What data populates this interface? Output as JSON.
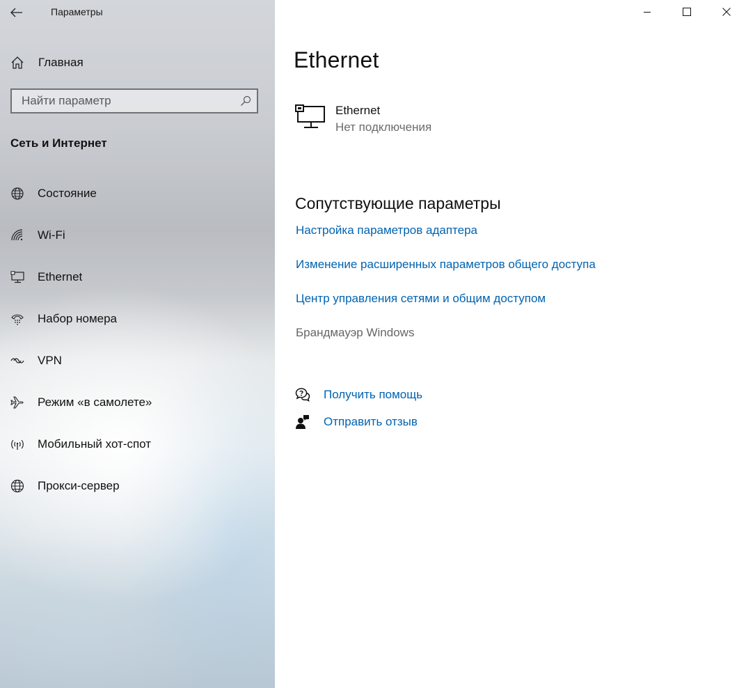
{
  "window": {
    "app_title": "Параметры",
    "controls": [
      "minimize",
      "maximize",
      "close"
    ]
  },
  "sidebar": {
    "home_label": "Главная",
    "search": {
      "placeholder": "Найти параметр",
      "value": ""
    },
    "section_title": "Сеть и Интернет",
    "items": [
      {
        "label": "Состояние",
        "icon": "globe-status-icon"
      },
      {
        "label": "Wi-Fi",
        "icon": "wifi-icon"
      },
      {
        "label": "Ethernet",
        "icon": "ethernet-icon"
      },
      {
        "label": "Набор номера",
        "icon": "dialup-icon"
      },
      {
        "label": "VPN",
        "icon": "vpn-icon"
      },
      {
        "label": "Режим «в самолете»",
        "icon": "airplane-icon"
      },
      {
        "label": "Мобильный хот-спот",
        "icon": "hotspot-icon"
      },
      {
        "label": "Прокси-сервер",
        "icon": "globe-icon"
      }
    ]
  },
  "main": {
    "title": "Ethernet",
    "device": {
      "name": "Ethernet",
      "status": "Нет подключения"
    },
    "related": {
      "title": "Сопутствующие параметры",
      "links": [
        {
          "label": "Настройка параметров адаптера",
          "enabled": true
        },
        {
          "label": "Изменение расширенных параметров общего доступа",
          "enabled": true
        },
        {
          "label": "Центр управления сетями и общим доступом",
          "enabled": true
        },
        {
          "label": "Брандмауэр Windows",
          "enabled": false
        }
      ]
    },
    "help": {
      "get_help": "Получить помощь",
      "feedback": "Отправить отзыв"
    }
  },
  "colors": {
    "link": "#0063b1",
    "disabled_link": "#666666"
  }
}
